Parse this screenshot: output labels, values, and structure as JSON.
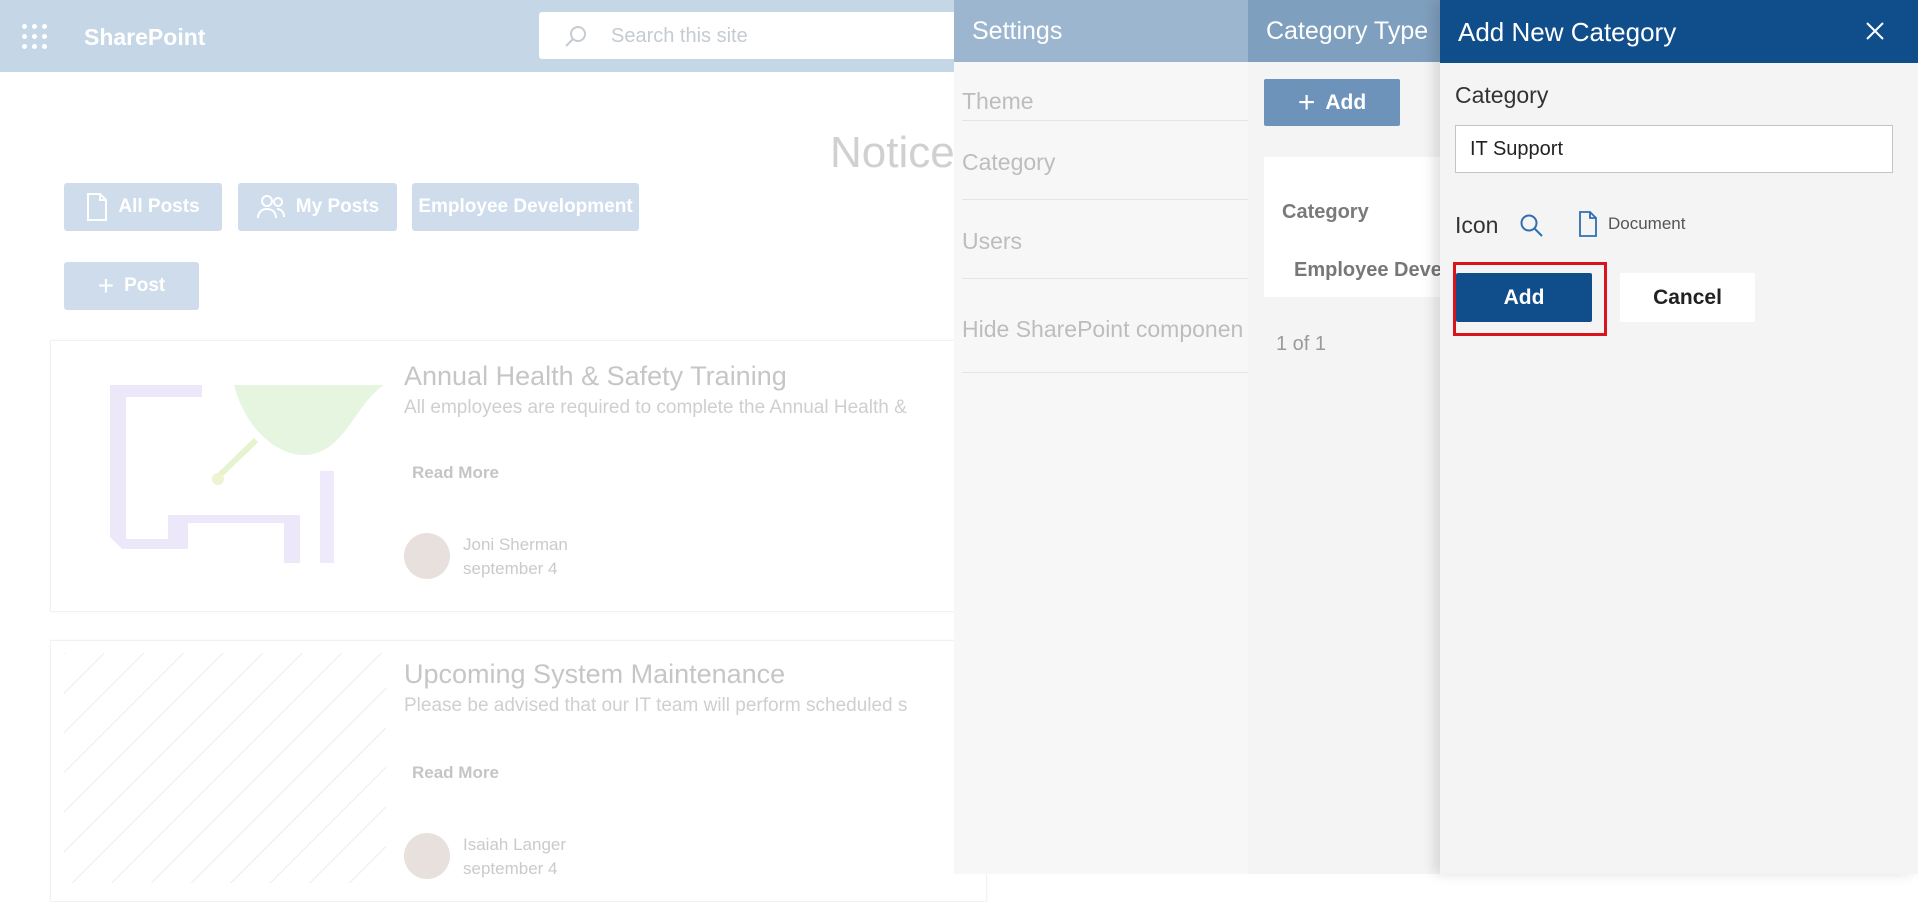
{
  "suite": {
    "app_name": "SharePoint",
    "search_placeholder": "Search this site"
  },
  "page": {
    "title": "Notice",
    "filters": [
      {
        "label": "All Posts",
        "icon": "document-icon"
      },
      {
        "label": "My Posts",
        "icon": "people-icon"
      },
      {
        "label": "Employee Development"
      }
    ],
    "post_button": "Post",
    "cards": [
      {
        "title": "Annual Health & Safety Training",
        "description": "All employees are required to complete the Annual Health &",
        "read_more": "Read More",
        "author": "Joni Sherman",
        "date": "september 4"
      },
      {
        "title": "Upcoming System Maintenance",
        "description": "Please be advised that our IT team will perform scheduled s",
        "read_more": "Read More",
        "author": "Isaiah Langer",
        "date": "september 4"
      }
    ]
  },
  "settings_panel": {
    "title": "Settings",
    "items": [
      "Theme",
      "Category",
      "Users",
      "Hide SharePoint componen"
    ]
  },
  "category_type_panel": {
    "title": "Category Type",
    "add_label": "Add",
    "column_header": "Category",
    "rows": [
      "Employee Deve"
    ],
    "pagination": "1 of 1"
  },
  "add_category_panel": {
    "title": "Add New Category",
    "category_label": "Category",
    "category_value": "IT Support",
    "icon_label": "Icon",
    "selected_icon_name": "Document",
    "add_button": "Add",
    "cancel_button": "Cancel"
  },
  "colors": {
    "primary": "#104e8b",
    "highlight": "#d9141c"
  }
}
